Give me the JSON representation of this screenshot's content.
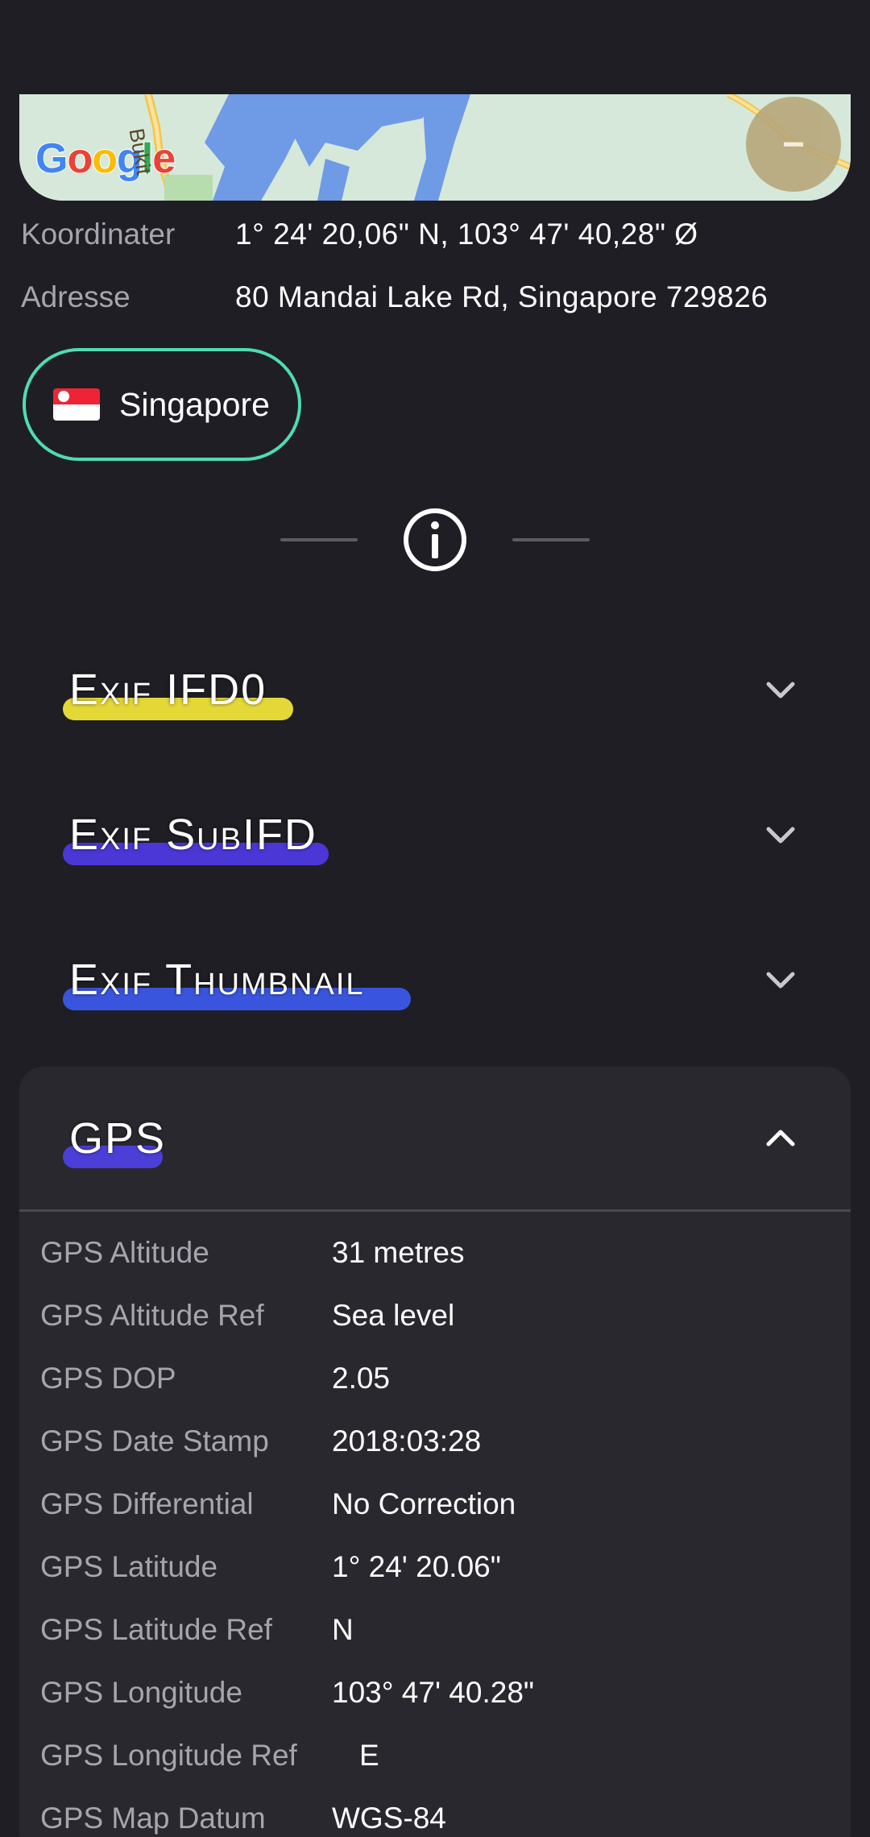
{
  "map": {
    "logo_letters": [
      "G",
      "o",
      "o",
      "g",
      "l",
      "e"
    ],
    "logo_colors": [
      "#4285f4",
      "#ea4335",
      "#fbbc05",
      "#4285f4",
      "#34a853",
      "#ea4335"
    ],
    "road_label": "Bukit",
    "zoom_out_symbol": "−"
  },
  "location": {
    "coordinates_label": "Koordinater",
    "coordinates_value": "1° 24' 20,06\" N, 103° 47' 40,28\" Ø",
    "address_label": "Adresse",
    "address_value": "80 Mandai Lake Rd, Singapore 729826"
  },
  "country_chip": {
    "label": "Singapore",
    "accent": "#4fdcae"
  },
  "sections": [
    {
      "title": "Exif IFD0",
      "highlight_color": "#e4d836",
      "expanded": false
    },
    {
      "title": "Exif SubIFD",
      "highlight_color": "#4b36d6",
      "expanded": false
    },
    {
      "title": "Exif Thumbnail",
      "highlight_color": "#3a55dd",
      "expanded": false
    },
    {
      "title": "GPS",
      "highlight_color": "#4b3fd8",
      "expanded": true
    }
  ],
  "gps_fields": [
    {
      "label": "GPS Altitude",
      "value": "31 metres"
    },
    {
      "label": "GPS Altitude Ref",
      "value": "Sea level"
    },
    {
      "label": "GPS DOP",
      "value": "2.05"
    },
    {
      "label": "GPS Date Stamp",
      "value": "2018:03:28"
    },
    {
      "label": "GPS Differential",
      "value": "No Correction"
    },
    {
      "label": "GPS Latitude",
      "value": "1° 24' 20.06\""
    },
    {
      "label": "GPS Latitude Ref",
      "value": "N"
    },
    {
      "label": "GPS Longitude",
      "value": "103° 47' 40.28\""
    },
    {
      "label": "GPS Longitude Ref",
      "value": "E"
    },
    {
      "label": "GPS Map Datum",
      "value": "WGS-84"
    }
  ]
}
